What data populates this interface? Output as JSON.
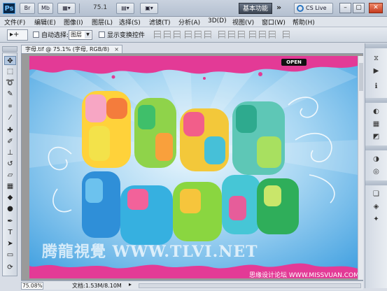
{
  "appbar": {
    "logo": "Ps",
    "br_label": "Br",
    "mb_label": "Mb",
    "zoom": "75.1",
    "workspace_button": "基本功能",
    "overflow": "»",
    "cslive": "CS Live",
    "min": "–",
    "restore": "▢",
    "close": "✕"
  },
  "menu": [
    "文件(F)",
    "编辑(E)",
    "图像(I)",
    "图层(L)",
    "选择(S)",
    "滤镜(T)",
    "分析(A)",
    "3D(D)",
    "视图(V)",
    "窗口(W)",
    "帮助(H)"
  ],
  "options": {
    "tool_preset": "▸+",
    "auto_select_label": "自动选择:",
    "auto_select_value": "图层",
    "show_transform_label": "显示变换控件"
  },
  "document": {
    "tab_title": "字母.tif @ 75.1% (字母, RGB/8)",
    "tab_close": "×",
    "open_badge": "OPEN"
  },
  "canvas_art": {
    "row1": [
      "P",
      "A",
      "R",
      "A"
    ],
    "row2": [
      "U",
      "S",
      "Z",
      "E",
      "K"
    ]
  },
  "watermark": {
    "main": "腾龍視覺 WWW.TLVI.NET",
    "corner_prefix": "思缘设计论坛",
    "corner_site": "WWW.MISSVUAN.COM"
  },
  "status": {
    "zoom": "75.08%",
    "doc_info": "文档:1.53M/8.10M",
    "arrow": "▸"
  },
  "toolbox_icons": [
    "move-tool",
    "marquee-tool",
    "lasso-tool",
    "quick-select-tool",
    "crop-tool",
    "eyedropper-tool",
    "healing-brush-tool",
    "brush-tool",
    "clone-stamp-tool",
    "history-brush-tool",
    "eraser-tool",
    "gradient-tool",
    "blur-tool",
    "dodge-tool",
    "pen-tool",
    "type-tool",
    "path-select-tool",
    "shape-tool",
    "3d-rotate-tool",
    "3d-orbit-tool",
    "hand-tool",
    "zoom-tool"
  ],
  "dock_icons": [
    "history-icon",
    "actions-icon",
    "color-icon",
    "swatches-icon",
    "styles-icon",
    "adjustments-icon",
    "masks-icon",
    "layers-icon",
    "channels-icon",
    "paths-icon"
  ],
  "colors": {
    "sky_top": "#3f9fe0",
    "sky_bottom": "#d3ecf9",
    "pink_splash": "#e33a96",
    "accent": "#2a74c0"
  }
}
